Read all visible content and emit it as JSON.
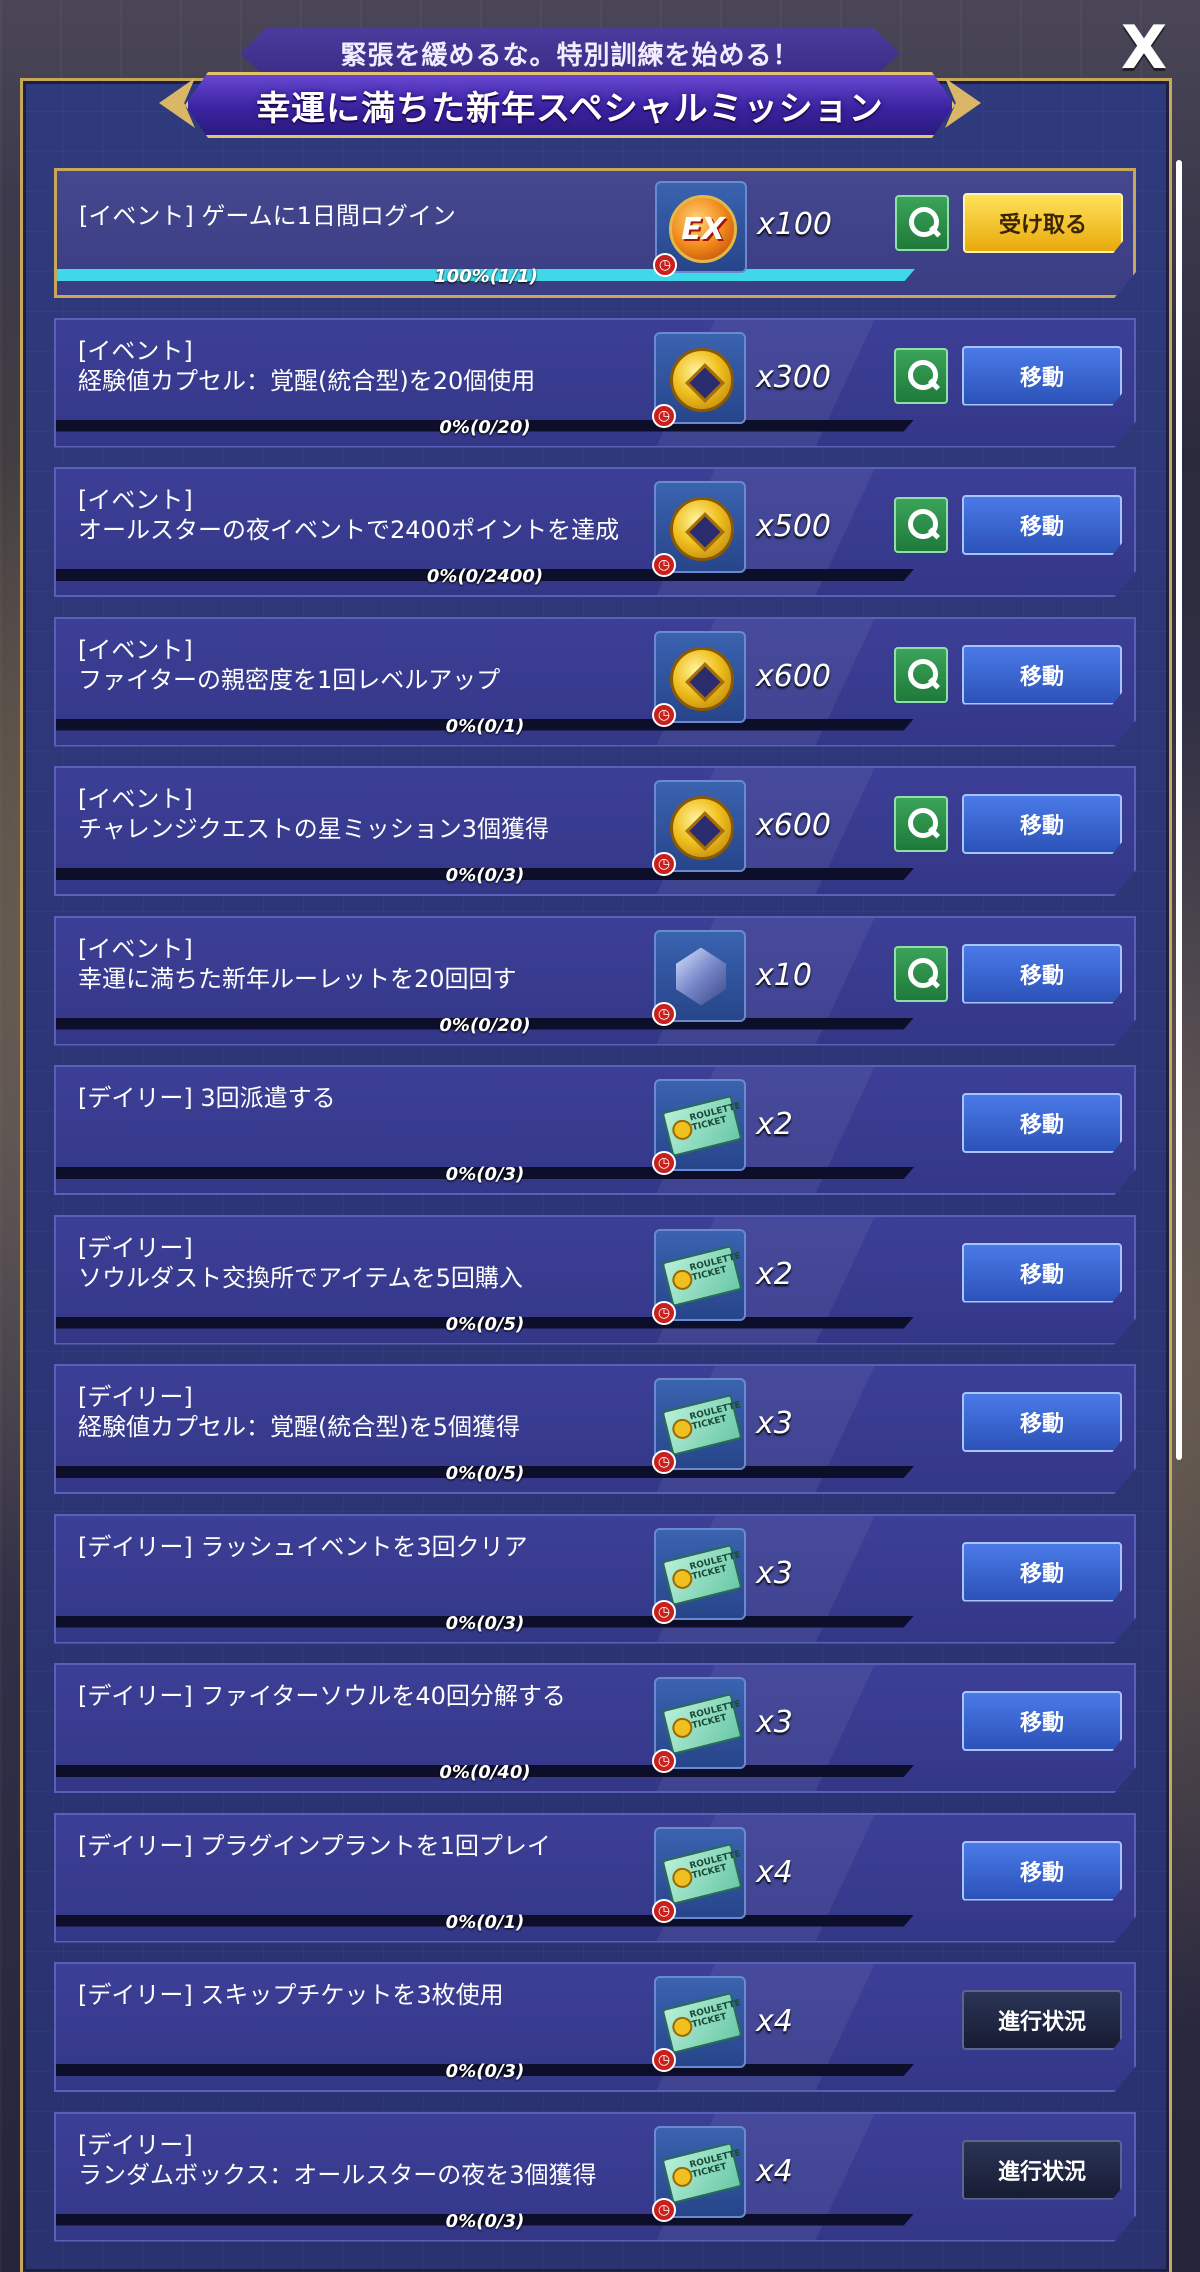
{
  "header": {
    "subtitle": "緊張を緩めるな。特別訓練を始める！",
    "title": "幸運に満ちた新年スペシャルミッション",
    "close_label": "X"
  },
  "missions": [
    {
      "title": "[イベント] ゲームに1日間ログイン",
      "progress": "100%(1/1)",
      "progress_fraction": 1.0,
      "reward_icon": "ex-medal-icon",
      "qty": "x100",
      "search": true,
      "action": "受け取る",
      "action_type": "claim",
      "done": true
    },
    {
      "title": "[イベント]\n経験値カプセル：覚醒(統合型)を20個使用",
      "progress": "0%(0/20)",
      "progress_fraction": 0,
      "reward_icon": "gold-coin-icon",
      "qty": "x300",
      "search": true,
      "action": "移動",
      "action_type": "move"
    },
    {
      "title": "[イベント]\nオールスターの夜イベントで2400ポイントを達成",
      "progress": "0%(0/2400)",
      "progress_fraction": 0,
      "reward_icon": "gold-coin-icon",
      "qty": "x500",
      "search": true,
      "action": "移動",
      "action_type": "move"
    },
    {
      "title": "[イベント]\nファイターの親密度を1回レベルアップ",
      "progress": "0%(0/1)",
      "progress_fraction": 0,
      "reward_icon": "gold-coin-icon",
      "qty": "x600",
      "search": true,
      "action": "移動",
      "action_type": "move"
    },
    {
      "title": "[イベント]\nチャレンジクエストの星ミッション3個獲得",
      "progress": "0%(0/3)",
      "progress_fraction": 0,
      "reward_icon": "gold-coin-icon",
      "qty": "x600",
      "search": true,
      "action": "移動",
      "action_type": "move"
    },
    {
      "title": "[イベント]\n幸運に満ちた新年ルーレットを20回回す",
      "progress": "0%(0/20)",
      "progress_fraction": 0,
      "reward_icon": "crystal-gem-icon",
      "qty": "x10",
      "search": true,
      "action": "移動",
      "action_type": "move"
    },
    {
      "title": "[デイリー] 3回派遣する",
      "progress": "0%(0/3)",
      "progress_fraction": 0,
      "reward_icon": "roulette-ticket-icon",
      "qty": "x2",
      "search": false,
      "action": "移動",
      "action_type": "move"
    },
    {
      "title": "[デイリー]\nソウルダスト交換所でアイテムを5回購入",
      "progress": "0%(0/5)",
      "progress_fraction": 0,
      "reward_icon": "roulette-ticket-icon",
      "qty": "x2",
      "search": false,
      "action": "移動",
      "action_type": "move"
    },
    {
      "title": "[デイリー]\n経験値カプセル：覚醒(統合型)を5個獲得",
      "progress": "0%(0/5)",
      "progress_fraction": 0,
      "reward_icon": "roulette-ticket-icon",
      "qty": "x3",
      "search": false,
      "action": "移動",
      "action_type": "move"
    },
    {
      "title": "[デイリー] ラッシュイベントを3回クリア",
      "progress": "0%(0/3)",
      "progress_fraction": 0,
      "reward_icon": "roulette-ticket-icon",
      "qty": "x3",
      "search": false,
      "action": "移動",
      "action_type": "move"
    },
    {
      "title": "[デイリー] ファイターソウルを40回分解する",
      "progress": "0%(0/40)",
      "progress_fraction": 0,
      "reward_icon": "roulette-ticket-icon",
      "qty": "x3",
      "search": false,
      "action": "移動",
      "action_type": "move"
    },
    {
      "title": "[デイリー] プラグインプラントを1回プレイ",
      "progress": "0%(0/1)",
      "progress_fraction": 0,
      "reward_icon": "roulette-ticket-icon",
      "qty": "x4",
      "search": false,
      "action": "移動",
      "action_type": "move"
    },
    {
      "title": "[デイリー] スキップチケットを3枚使用",
      "progress": "0%(0/3)",
      "progress_fraction": 0,
      "reward_icon": "roulette-ticket-icon",
      "qty": "x4",
      "search": false,
      "action": "進行状況",
      "action_type": "status"
    },
    {
      "title": "[デイリー]\nランダムボックス：オールスターの夜を3個獲得",
      "progress": "0%(0/3)",
      "progress_fraction": 0,
      "reward_icon": "roulette-ticket-icon",
      "qty": "x4",
      "search": false,
      "action": "進行状況",
      "action_type": "status"
    }
  ],
  "ex_medal_text": "EX",
  "ticket_text": "ROULETTE TICKET",
  "colors": {
    "accent_gold": "#c7a75a",
    "progress_cyan": "#3fd8e8",
    "move_blue": "#3a66d8",
    "claim_yellow": "#f3c21c"
  }
}
